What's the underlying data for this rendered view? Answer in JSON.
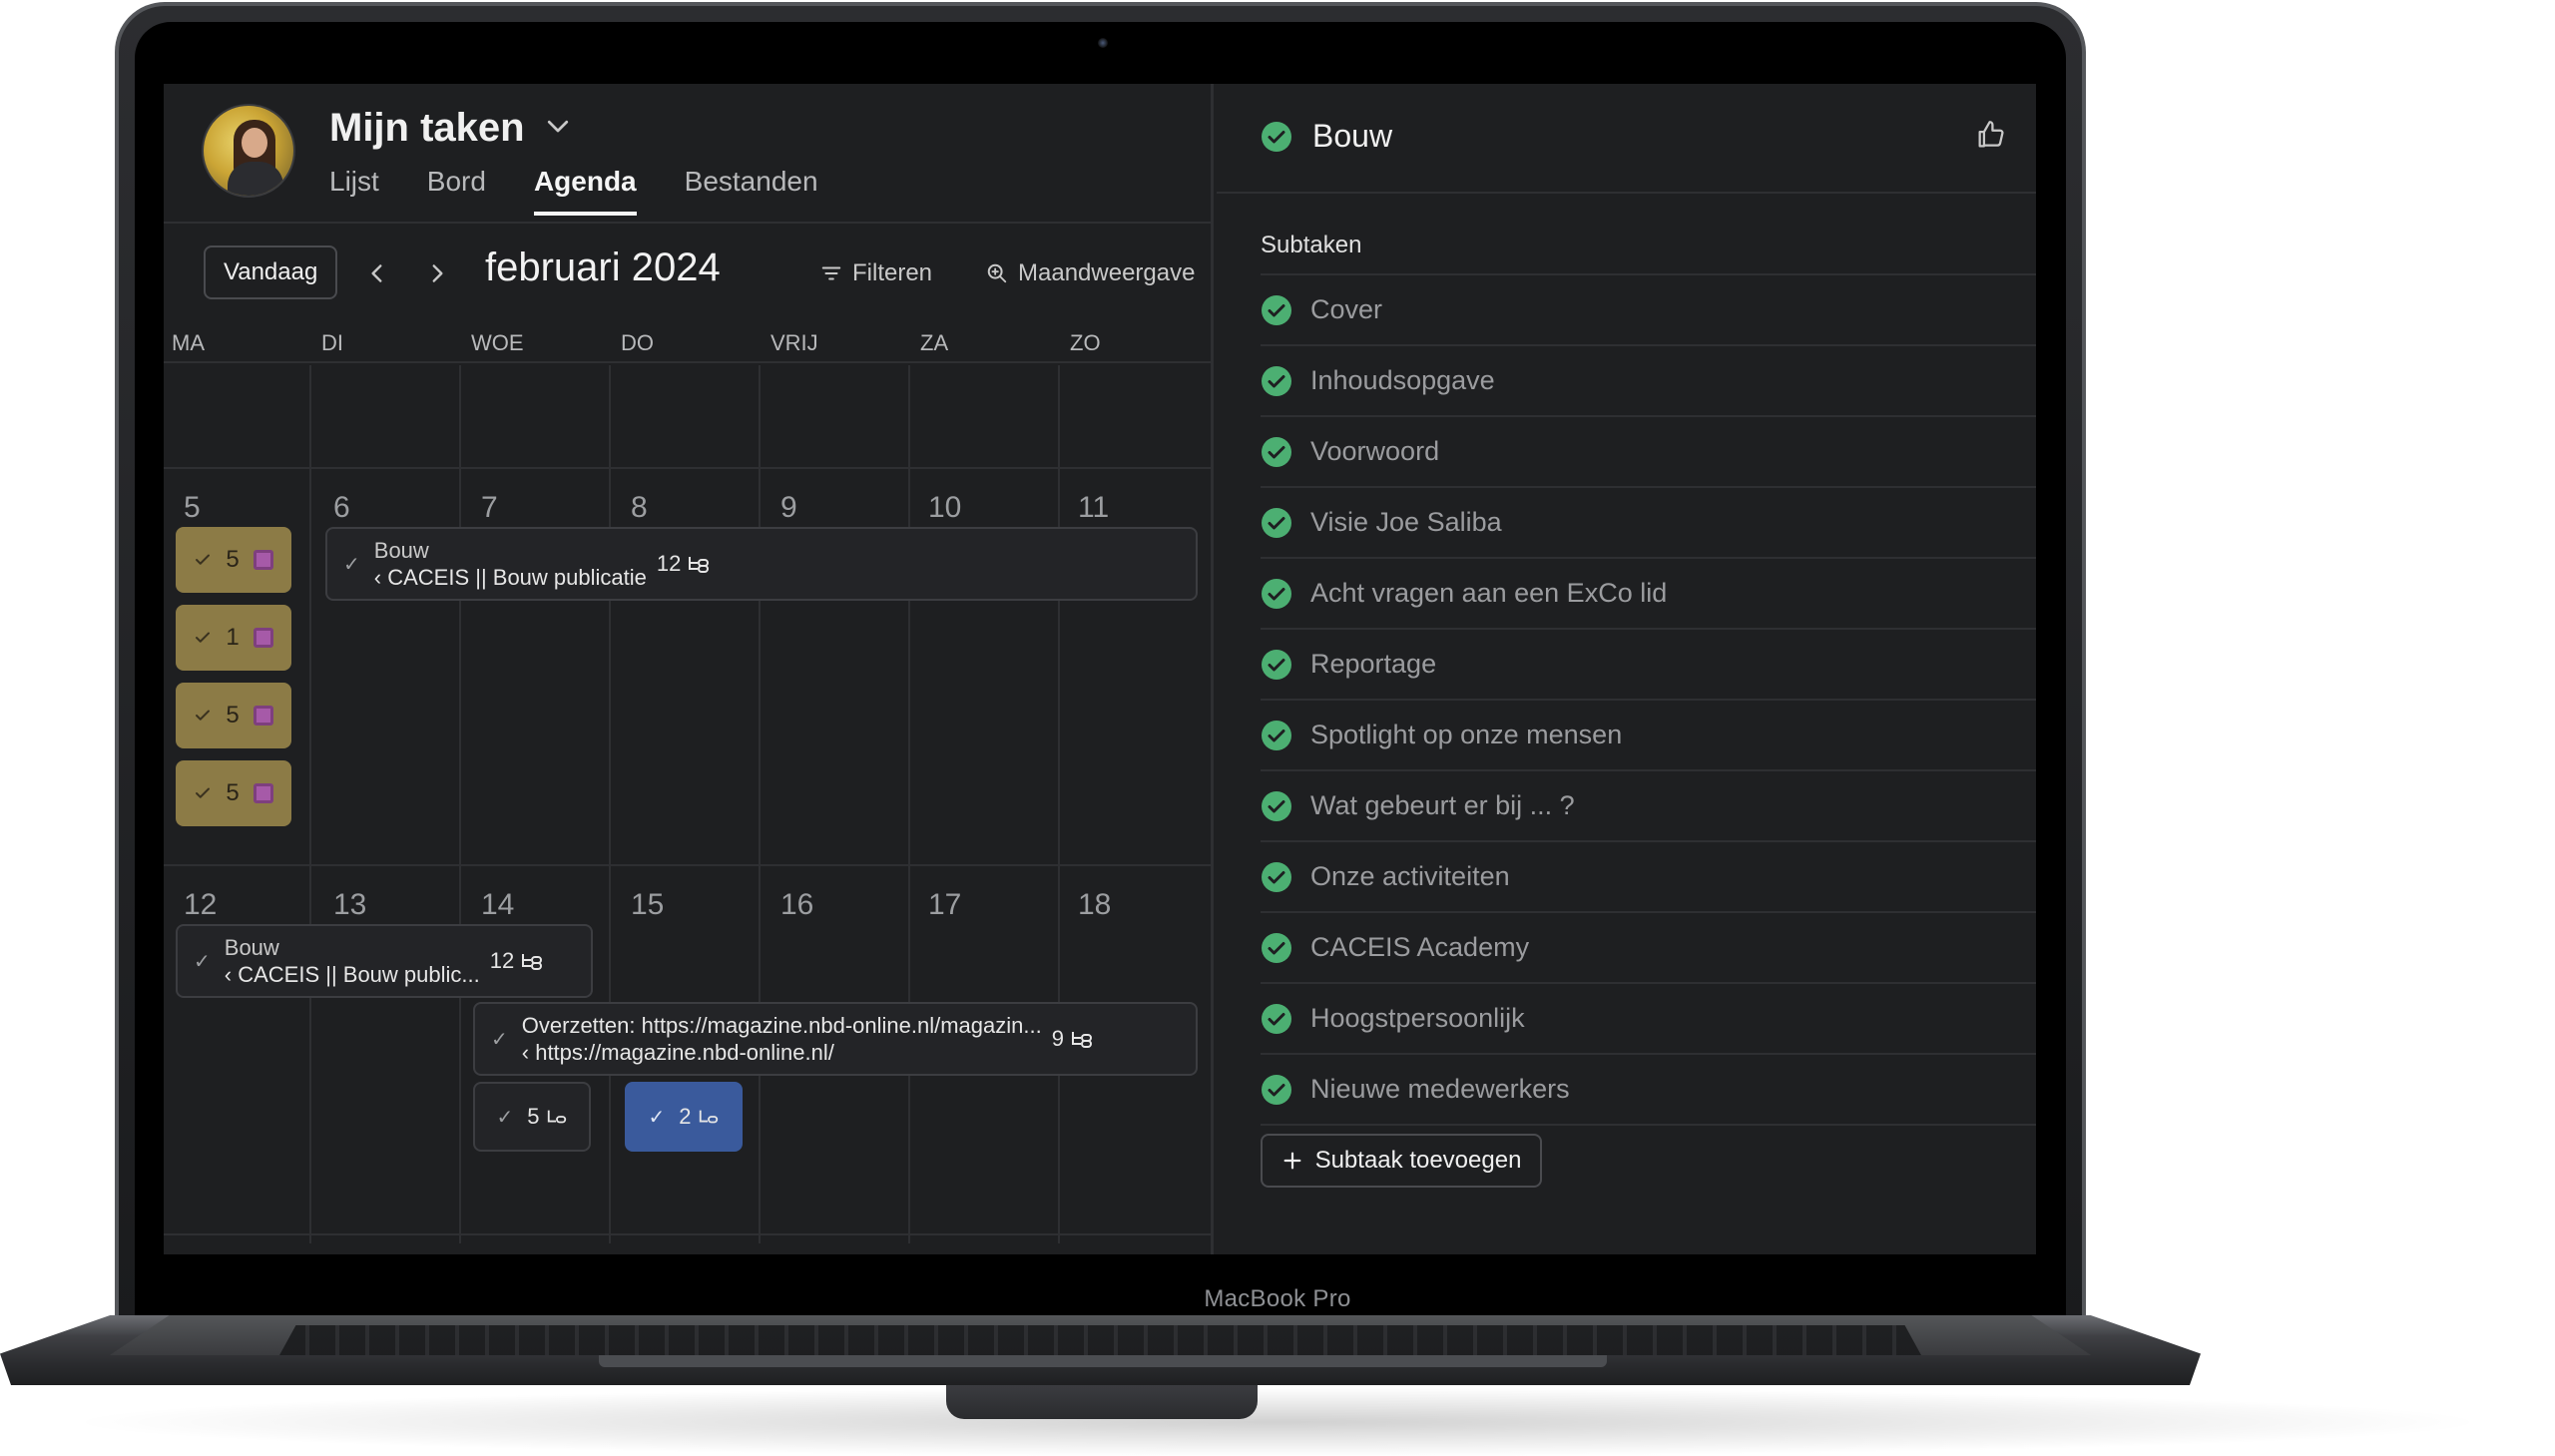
{
  "device": {
    "label": "MacBook Pro"
  },
  "header": {
    "title": "Mijn taken",
    "tabs": [
      "Lijst",
      "Bord",
      "Agenda",
      "Bestanden"
    ],
    "active_tab": "Agenda"
  },
  "toolbar": {
    "today_label": "Vandaag",
    "month_label": "februari 2024",
    "filter_label": "Filteren",
    "view_label": "Maandweergave"
  },
  "calendar": {
    "weekdays": [
      "MA",
      "DI",
      "WOE",
      "DO",
      "VRIJ",
      "ZA",
      "ZO"
    ],
    "week1": [
      "5",
      "6",
      "7",
      "8",
      "9",
      "10",
      "11"
    ],
    "week2": [
      "12",
      "13",
      "14",
      "15",
      "16",
      "17",
      "18"
    ],
    "chips": [
      "5",
      "1",
      "5",
      "5"
    ],
    "events": [
      {
        "line1": "Bouw",
        "line2": "‹ CACEIS || Bouw publicatie",
        "count": "12"
      },
      {
        "line1": "Bouw",
        "line2": "‹ CACEIS || Bouw public...",
        "count": "12"
      },
      {
        "line1": "Overzetten: https://magazine.nbd-online.nl/magazin...",
        "line2": "‹ https://magazine.nbd-online.nl/",
        "count": "9"
      },
      {
        "count": "5"
      },
      {
        "count": "2"
      }
    ]
  },
  "detail": {
    "title": "Bouw",
    "subtasks_label": "Subtaken",
    "subtasks": [
      "Cover",
      "Inhoudsopgave",
      "Voorwoord",
      "Visie Joe Saliba",
      "Acht vragen aan een ExCo lid",
      "Reportage",
      "Spotlight op onze mensen",
      "Wat gebeurt er bij ... ?",
      "Onze activiteiten",
      "CACEIS Academy",
      "Hoogstpersoonlijk",
      "Nieuwe medewerkers"
    ],
    "add_subtask_label": "Subtaak toevoegen"
  },
  "colors": {
    "screen_bg": "#1e1f21",
    "check_green": "#4caf72",
    "chip_gold": "#8c7b46",
    "event_blue": "#3a5a9c",
    "marker_purple": "#a65aa8"
  },
  "icons": {
    "header_dropdown": "chevron-down-icon",
    "prev": "chevron-left-icon",
    "next": "chevron-right-icon",
    "filter": "filter-icon",
    "view": "zoom-icon",
    "subtask_marker": "subtask-icon",
    "like": "thumbs-up-icon",
    "add": "plus-icon",
    "done": "check-circle-icon"
  }
}
